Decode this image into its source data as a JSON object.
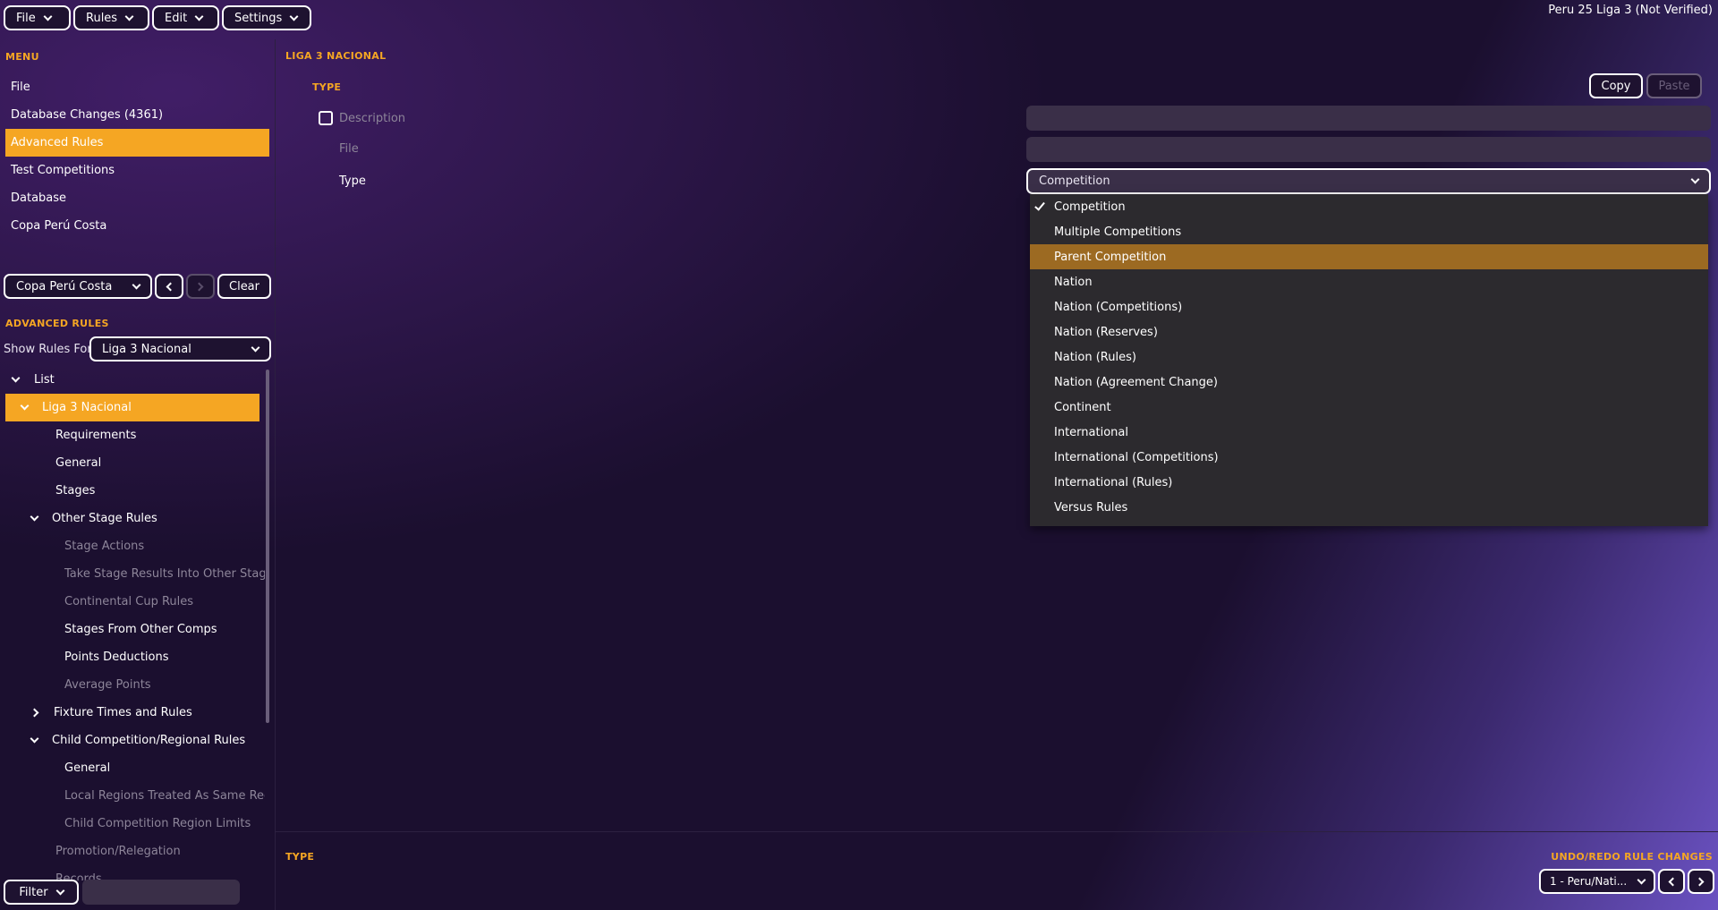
{
  "topbar": {
    "menus": [
      {
        "label": "File"
      },
      {
        "label": "Rules"
      },
      {
        "label": "Edit"
      },
      {
        "label": "Settings"
      }
    ],
    "title": "Peru 25 Liga 3 (Not Verified)"
  },
  "sidebar": {
    "menu_heading": "MENU",
    "menu_items": [
      {
        "label": "File"
      },
      {
        "label": "Database Changes (4361)"
      },
      {
        "label": "Advanced Rules"
      },
      {
        "label": "Test Competitions"
      },
      {
        "label": "Database"
      },
      {
        "label": "Copa Perú Costa"
      }
    ],
    "nav_select": "Copa Perú Costa",
    "clear_label": "Clear",
    "advanced_heading": "ADVANCED RULES",
    "show_rules_label": "Show Rules For",
    "show_rules_value": "Liga 3 Nacional",
    "tree": [
      {
        "label": "List",
        "icon": "chevron-down"
      },
      {
        "label": "Liga 3 Nacional",
        "icon": "chevron-down"
      },
      {
        "label": "Requirements"
      },
      {
        "label": "General"
      },
      {
        "label": "Stages"
      },
      {
        "label": "Other Stage Rules",
        "icon": "chevron-down"
      },
      {
        "label": "Stage Actions"
      },
      {
        "label": "Take Stage Results Into Other Stage"
      },
      {
        "label": "Continental Cup Rules"
      },
      {
        "label": "Stages From Other Comps"
      },
      {
        "label": "Points Deductions"
      },
      {
        "label": "Average Points"
      },
      {
        "label": "Fixture Times and Rules",
        "icon": "chevron-right"
      },
      {
        "label": "Child Competition/Regional Rules",
        "icon": "chevron-down"
      },
      {
        "label": "General"
      },
      {
        "label": "Local Regions Treated As Same Region"
      },
      {
        "label": "Child Competition Region Limits"
      },
      {
        "label": "Promotion/Relegation"
      },
      {
        "label": "Records"
      }
    ],
    "filter_label": "Filter"
  },
  "main": {
    "heading": "LIGA 3 NACIONAL",
    "type_heading": "TYPE",
    "copy_label": "Copy",
    "paste_label": "Paste",
    "fields": {
      "description_label": "Description",
      "file_label": "File",
      "type_label": "Type",
      "type_value": "Competition"
    },
    "dropdown_options": [
      {
        "label": "Competition"
      },
      {
        "label": "Multiple Competitions"
      },
      {
        "label": "Parent Competition"
      },
      {
        "label": "Nation"
      },
      {
        "label": "Nation (Competitions)"
      },
      {
        "label": "Nation (Reserves)"
      },
      {
        "label": "Nation (Rules)"
      },
      {
        "label": "Nation (Agreement Change)"
      },
      {
        "label": "Continent"
      },
      {
        "label": "International"
      },
      {
        "label": "International (Competitions)"
      },
      {
        "label": "International (Rules)"
      },
      {
        "label": "Versus Rules"
      }
    ],
    "dropdown_selected_index": 0,
    "dropdown_hover_index": 2
  },
  "bottom": {
    "type_heading": "TYPE",
    "undo_heading": "UNDO/REDO RULE CHANGES",
    "undo_select": "1 - Peru/Nati..."
  },
  "colors": {
    "accent": "#f5a623",
    "background": "#1b0f2f",
    "hover": "#9c6a22"
  }
}
